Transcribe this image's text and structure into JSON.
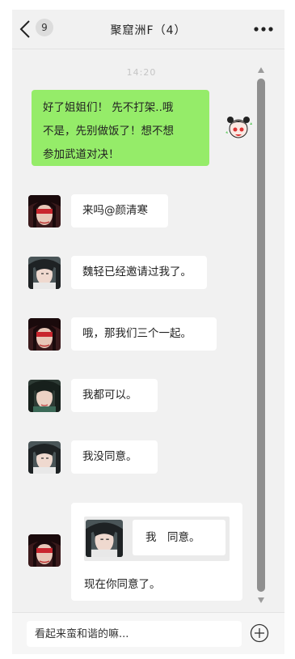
{
  "header": {
    "unread_count": "9",
    "title": "聚窟洲F（4）"
  },
  "timestamp": "14:20",
  "messages": [
    {
      "sender": "self",
      "text_lines": [
        "好了姐姐们！ 先不打架..哦",
        "不是，先别做饭了！想不想",
        "参加武道对决！"
      ]
    },
    {
      "sender": "red-masked-character",
      "text": "来吗@颜清寒"
    },
    {
      "sender": "white-haired-character",
      "text": "魏轻已经邀请过我了。"
    },
    {
      "sender": "red-masked-character",
      "text": "哦，那我们三个一起。"
    },
    {
      "sender": "dark-haired-character",
      "text": "我都可以。"
    },
    {
      "sender": "white-haired-character",
      "text": "我没同意。"
    },
    {
      "sender": "red-masked-character",
      "quoted_text": "我　同意。",
      "text": "现在你同意了。"
    }
  ],
  "composer": {
    "placeholder": "看起来蛮和谐的嘛..."
  },
  "colors": {
    "self_bubble": "#95ec69",
    "background": "#f1f1f1"
  }
}
